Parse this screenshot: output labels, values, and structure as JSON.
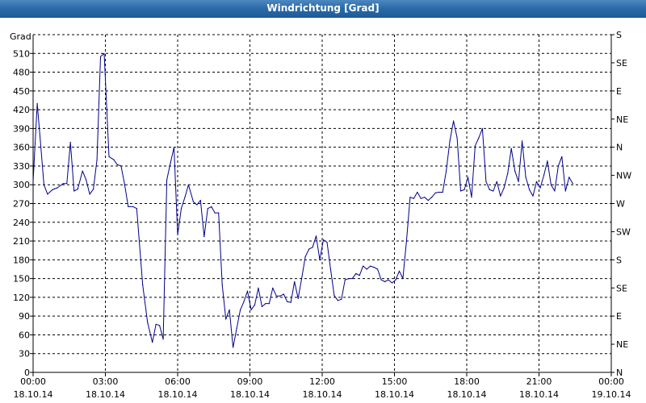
{
  "window": {
    "title": "Windrichtung [Grad]"
  },
  "chart_data": {
    "type": "line",
    "title": "Windrichtung [Grad]",
    "ylabel": "Grad",
    "ylim": [
      0,
      540
    ],
    "xlim": [
      "18.10.14 00:00",
      "19.10.14 00:00"
    ],
    "grid": true,
    "y_ticks": [
      0,
      30,
      60,
      90,
      120,
      150,
      180,
      210,
      240,
      270,
      300,
      330,
      360,
      390,
      420,
      450,
      480,
      510
    ],
    "x_ticks": [
      {
        "time": "00:00",
        "date": "18.10.14",
        "hour": 0
      },
      {
        "time": "03:00",
        "date": "18.10.14",
        "hour": 3
      },
      {
        "time": "06:00",
        "date": "18.10.14",
        "hour": 6
      },
      {
        "time": "09:00",
        "date": "18.10.14",
        "hour": 9
      },
      {
        "time": "12:00",
        "date": "18.10.14",
        "hour": 12
      },
      {
        "time": "15:00",
        "date": "18.10.14",
        "hour": 15
      },
      {
        "time": "18:00",
        "date": "18.10.14",
        "hour": 18
      },
      {
        "time": "21:00",
        "date": "18.10.14",
        "hour": 21
      },
      {
        "time": "00:00",
        "date": "19.10.14",
        "hour": 24
      }
    ],
    "right_ticks": [
      {
        "label": "N",
        "value": 0
      },
      {
        "label": "NE",
        "value": 45
      },
      {
        "label": "E",
        "value": 90
      },
      {
        "label": "SE",
        "value": 135
      },
      {
        "label": "S",
        "value": 180
      },
      {
        "label": "SW",
        "value": 225
      },
      {
        "label": "W",
        "value": 270
      },
      {
        "label": "NW",
        "value": 315
      },
      {
        "label": "N",
        "value": 360
      },
      {
        "label": "NE",
        "value": 405
      },
      {
        "label": "E",
        "value": 450
      },
      {
        "label": "SE",
        "value": 495
      },
      {
        "label": "S",
        "value": 540
      }
    ],
    "series": [
      {
        "color": "#00008b",
        "points": [
          [
            0.0,
            305
          ],
          [
            0.17,
            430
          ],
          [
            0.3,
            370
          ],
          [
            0.45,
            300
          ],
          [
            0.6,
            285
          ],
          [
            0.8,
            292
          ],
          [
            1.0,
            295
          ],
          [
            1.25,
            302
          ],
          [
            1.4,
            302
          ],
          [
            1.55,
            368
          ],
          [
            1.7,
            290
          ],
          [
            1.85,
            293
          ],
          [
            2.05,
            322
          ],
          [
            2.2,
            308
          ],
          [
            2.35,
            285
          ],
          [
            2.5,
            293
          ],
          [
            2.65,
            340
          ],
          [
            2.8,
            505
          ],
          [
            2.95,
            510
          ],
          [
            3.15,
            345
          ],
          [
            3.35,
            340
          ],
          [
            3.5,
            332
          ],
          [
            3.65,
            330
          ],
          [
            3.8,
            300
          ],
          [
            3.95,
            265
          ],
          [
            4.15,
            265
          ],
          [
            4.3,
            262
          ],
          [
            4.55,
            140
          ],
          [
            4.75,
            80
          ],
          [
            4.95,
            48
          ],
          [
            5.1,
            77
          ],
          [
            5.25,
            75
          ],
          [
            5.4,
            53
          ],
          [
            5.55,
            308
          ],
          [
            5.7,
            335
          ],
          [
            5.85,
            360
          ],
          [
            6.0,
            220
          ],
          [
            6.15,
            262
          ],
          [
            6.3,
            280
          ],
          [
            6.45,
            300
          ],
          [
            6.65,
            273
          ],
          [
            6.8,
            268
          ],
          [
            6.95,
            275
          ],
          [
            7.1,
            217
          ],
          [
            7.25,
            262
          ],
          [
            7.4,
            265
          ],
          [
            7.55,
            255
          ],
          [
            7.7,
            255
          ],
          [
            7.85,
            140
          ],
          [
            8.0,
            85
          ],
          [
            8.15,
            100
          ],
          [
            8.3,
            40
          ],
          [
            8.45,
            70
          ],
          [
            8.6,
            100
          ],
          [
            8.75,
            113
          ],
          [
            8.9,
            130
          ],
          [
            9.05,
            100
          ],
          [
            9.2,
            108
          ],
          [
            9.35,
            135
          ],
          [
            9.5,
            105
          ],
          [
            9.65,
            110
          ],
          [
            9.8,
            110
          ],
          [
            9.95,
            135
          ],
          [
            10.1,
            122
          ],
          [
            10.25,
            122
          ],
          [
            10.4,
            125
          ],
          [
            10.55,
            113
          ],
          [
            10.7,
            112
          ],
          [
            10.85,
            145
          ],
          [
            11.0,
            118
          ],
          [
            11.15,
            150
          ],
          [
            11.3,
            185
          ],
          [
            11.45,
            197
          ],
          [
            11.6,
            200
          ],
          [
            11.75,
            218
          ],
          [
            11.9,
            180
          ],
          [
            12.05,
            212
          ],
          [
            12.2,
            208
          ],
          [
            12.35,
            165
          ],
          [
            12.5,
            123
          ],
          [
            12.65,
            115
          ],
          [
            12.8,
            117
          ],
          [
            12.95,
            148
          ],
          [
            13.1,
            150
          ],
          [
            13.25,
            150
          ],
          [
            13.4,
            158
          ],
          [
            13.55,
            155
          ],
          [
            13.7,
            170
          ],
          [
            13.85,
            165
          ],
          [
            14.0,
            170
          ],
          [
            14.15,
            168
          ],
          [
            14.3,
            165
          ],
          [
            14.45,
            148
          ],
          [
            14.6,
            145
          ],
          [
            14.75,
            148
          ],
          [
            14.9,
            143
          ],
          [
            15.05,
            148
          ],
          [
            15.2,
            162
          ],
          [
            15.35,
            150
          ],
          [
            15.5,
            210
          ],
          [
            15.65,
            280
          ],
          [
            15.8,
            278
          ],
          [
            15.95,
            288
          ],
          [
            16.1,
            278
          ],
          [
            16.25,
            280
          ],
          [
            16.4,
            275
          ],
          [
            16.55,
            280
          ],
          [
            16.7,
            287
          ],
          [
            16.85,
            288
          ],
          [
            17.0,
            288
          ],
          [
            17.15,
            322
          ],
          [
            17.3,
            370
          ],
          [
            17.45,
            402
          ],
          [
            17.6,
            375
          ],
          [
            17.75,
            290
          ],
          [
            17.9,
            292
          ],
          [
            18.05,
            312
          ],
          [
            18.2,
            280
          ],
          [
            18.35,
            362
          ],
          [
            18.5,
            375
          ],
          [
            18.65,
            390
          ],
          [
            18.8,
            305
          ],
          [
            18.95,
            292
          ],
          [
            19.1,
            290
          ],
          [
            19.25,
            305
          ],
          [
            19.4,
            282
          ],
          [
            19.55,
            295
          ],
          [
            19.7,
            318
          ],
          [
            19.85,
            358
          ],
          [
            20.0,
            322
          ],
          [
            20.15,
            305
          ],
          [
            20.3,
            370
          ],
          [
            20.45,
            312
          ],
          [
            20.6,
            292
          ],
          [
            20.75,
            282
          ],
          [
            20.9,
            305
          ],
          [
            21.05,
            295
          ],
          [
            21.2,
            315
          ],
          [
            21.35,
            338
          ],
          [
            21.5,
            300
          ],
          [
            21.65,
            290
          ],
          [
            21.8,
            330
          ],
          [
            21.95,
            345
          ],
          [
            22.1,
            290
          ],
          [
            22.25,
            312
          ],
          [
            22.4,
            302
          ]
        ]
      }
    ]
  }
}
